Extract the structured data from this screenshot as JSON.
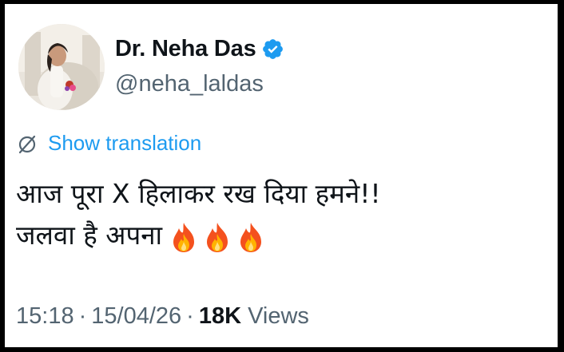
{
  "author": {
    "display_name": "Dr. Neha Das",
    "handle": "@neha_laldas",
    "avatar_icon": "profile-photo",
    "verified_icon": "verified-badge-icon",
    "verified_color": "#1d9bf0"
  },
  "tweet": {
    "translate_label": "Show translation",
    "translate_icon": "globe-slash-icon",
    "line1": "आज पूरा X हिलाकर रख दिया हमने!!",
    "line2": "जलवा है अपना",
    "emojis": [
      "fire-emoji",
      "fire-emoji",
      "fire-emoji"
    ]
  },
  "meta": {
    "time": "15:18",
    "separator": "·",
    "date": "15/04/26",
    "views_count": "18K",
    "views_label": "Views"
  },
  "colors": {
    "text_primary": "#0f1419",
    "text_secondary": "#536471",
    "link": "#1d9bf0",
    "frame": "#000000"
  }
}
